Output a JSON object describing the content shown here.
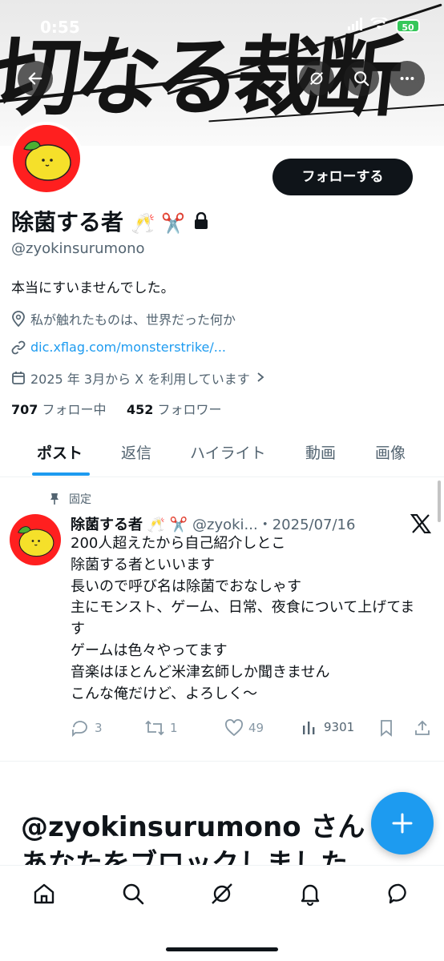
{
  "status_bar": {
    "time": "0:55",
    "battery": "50"
  },
  "banner": {
    "text": "切なる裁断"
  },
  "profile": {
    "follow_label": "フォローする",
    "display_name": "除菌する者",
    "name_emojis": "🥂 ✂️",
    "handle": "@zyokinsurumono",
    "bio": "本当にすいませんでした。",
    "location": "私が触れたものは、世界だった何か",
    "website": "dic.xflag.com/monsterstrike/...",
    "joined": "2025 年 3月から X を利用しています",
    "following_count": "707",
    "following_label": "フォロー中",
    "followers_count": "452",
    "followers_label": "フォロワー"
  },
  "tabs": [
    {
      "label": "ポスト",
      "active": true
    },
    {
      "label": "返信",
      "active": false
    },
    {
      "label": "ハイライト",
      "active": false
    },
    {
      "label": "動画",
      "active": false
    },
    {
      "label": "画像",
      "active": false
    }
  ],
  "pinned_tweet": {
    "pinned_label": "固定",
    "name": "除菌する者",
    "name_emojis": "🥂 ✂️",
    "handle_date": "@zyoki...・2025/07/16",
    "text": "200人超えたから自己紹介しとこ\n除菌する者といいます\n長いので呼び名は除菌でおなしゃす\n主にモンスト、ゲーム、日常、夜食について上げてます\nゲームは色々やってます\n音楽はほとんど米津玄師しか聞きません\nこんな俺だけど、よろしく〜",
    "replies": "3",
    "retweets": "1",
    "likes": "49",
    "views": "9301"
  },
  "blocked_notice": "@zyokinsurumono さん\nあなたをブロックしました",
  "colors": {
    "accent": "#1d9bf0",
    "text": "#0f1419",
    "muted": "#536471",
    "avatar_bg": "#ff1f1f"
  }
}
